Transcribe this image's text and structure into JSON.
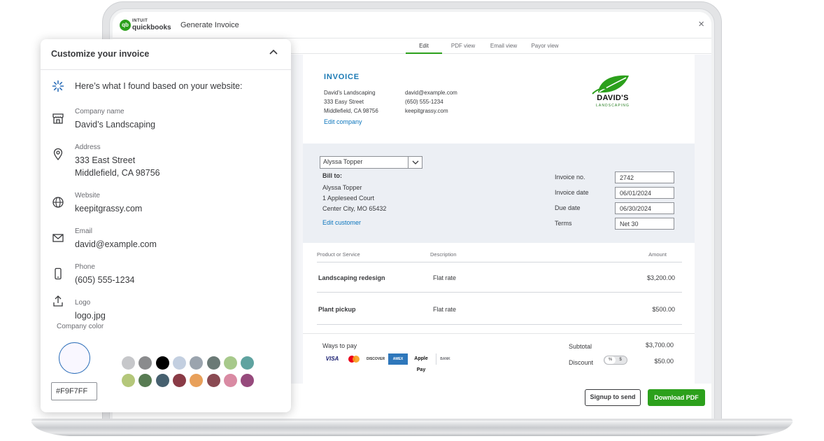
{
  "app": {
    "brand_small": "INTUIT",
    "brand_name": "quickbooks",
    "logo_mark": "qb",
    "window_title": "Generate Invoice",
    "close_glyph": "×"
  },
  "tabs": [
    {
      "label": "Edit",
      "active": true
    },
    {
      "label": "PDF view",
      "active": false
    },
    {
      "label": "Email view",
      "active": false
    },
    {
      "label": "Payor view",
      "active": false
    }
  ],
  "invoice": {
    "heading": "INVOICE",
    "company": {
      "name": "David's Landscaping",
      "street": "333 Easy Street",
      "city": "Middlefield, CA 98756",
      "email": "david@example.com",
      "phone": "(650) 555-1234",
      "website": "keepitgrassy.com",
      "edit_link": "Edit company"
    },
    "logo": {
      "name": "DAVID'S",
      "sub": "LANDSCAPING",
      "color": "#2ca01c"
    },
    "customer_select": "Alyssa Topper",
    "bill_to": {
      "label": "Bill to:",
      "name": "Alyssa Topper",
      "street": "1 Appleseed Court",
      "city": "Center City, MO 65432",
      "edit_link": "Edit customer"
    },
    "meta": [
      {
        "label": "Invoice no.",
        "value": "2742"
      },
      {
        "label": "Invoice date",
        "value": "06/01/2024"
      },
      {
        "label": "Due date",
        "value": "06/30/2024"
      },
      {
        "label": "Terms",
        "value": "Net 30"
      }
    ],
    "columns": {
      "product": "Product or Service",
      "description": "Description",
      "amount": "Amount"
    },
    "items": [
      {
        "name": "Landscaping redesign",
        "description": "Flat rate",
        "amount": "$3,200.00"
      },
      {
        "name": "Plant pickup",
        "description": "Flat rate",
        "amount": "$500.00"
      }
    ],
    "ways_to_pay": "Ways to pay",
    "payment_methods": [
      "VISA",
      "mastercard",
      "DISCOVER",
      "AMEX",
      "Apple Pay",
      "BANK"
    ],
    "subtotal_label": "Subtotal",
    "subtotal": "$3,700.00",
    "discount_label": "Discount",
    "discount_toggle": [
      "%",
      "$"
    ],
    "discount": "$50.00"
  },
  "actions": {
    "signup": "Signup to send",
    "download": "Download PDF"
  },
  "panel": {
    "title": "Customize your invoice",
    "found_text": "Here’s what I found based on your website:",
    "fields": [
      {
        "label": "Company name",
        "value": "David’s Landscaping",
        "icon": "store-icon"
      },
      {
        "label": "Address",
        "value": "333 East Street",
        "value2": "Middlefield, CA 98756",
        "icon": "location-pin-icon"
      },
      {
        "label": "Website",
        "value": "keepitgrassy.com",
        "icon": "globe-icon"
      },
      {
        "label": "Email",
        "value": "david@example.com",
        "icon": "envelope-icon"
      },
      {
        "label": "Phone",
        "value": "(605) 555-1234",
        "icon": "phone-icon"
      },
      {
        "label": "Logo",
        "value": "logo.jpg",
        "icon": "upload-icon"
      }
    ],
    "company_color_label": "Company color",
    "selected_color": "#F9F7FF",
    "palette": [
      "#c6c7ca",
      "#8a8b8d",
      "#000000",
      "#c3cfe0",
      "#9ba4ae",
      "#6b7a76",
      "#a7c98b",
      "#5fa3a0",
      "#b4c77a",
      "#577b52",
      "#46606f",
      "#8a3b46",
      "#e8a05a",
      "#8a4a52",
      "#d98aa3",
      "#964a7c"
    ]
  }
}
